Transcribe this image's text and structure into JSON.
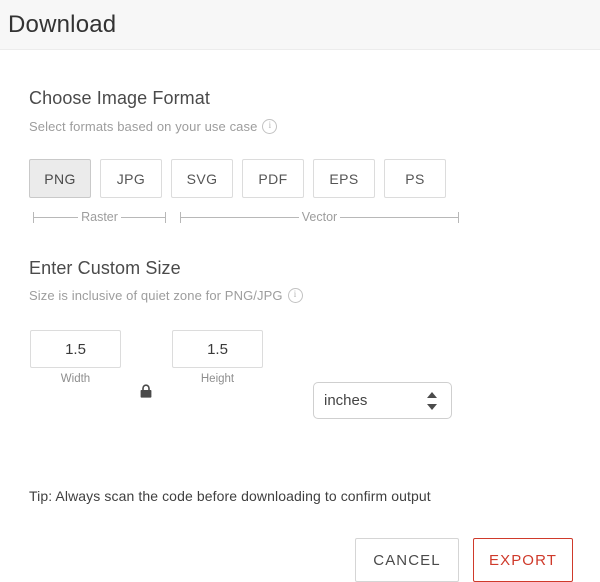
{
  "header": {
    "title": "Download"
  },
  "format_section": {
    "title": "Choose Image Format",
    "subtitle": "Select formats based on your use case",
    "info_icon": "info-circle-icon",
    "options": [
      {
        "label": "PNG",
        "selected": true
      },
      {
        "label": "JPG",
        "selected": false
      },
      {
        "label": "SVG",
        "selected": false
      },
      {
        "label": "PDF",
        "selected": false
      },
      {
        "label": "EPS",
        "selected": false
      },
      {
        "label": "PS",
        "selected": false
      }
    ],
    "groups": [
      {
        "label": "Raster"
      },
      {
        "label": "Vector"
      }
    ]
  },
  "size_section": {
    "title": "Enter Custom Size",
    "subtitle": "Size is inclusive of quiet zone for PNG/JPG",
    "info_icon": "info-circle-icon",
    "width": {
      "value": "1.5",
      "label": "Width"
    },
    "height": {
      "value": "1.5",
      "label": "Height"
    },
    "lock_icon": "lock-closed-icon",
    "unit": {
      "value": "inches",
      "arrows_icon": "stepper-arrows-icon"
    }
  },
  "tip": {
    "text": "Tip: Always scan the code before downloading to confirm output"
  },
  "footer": {
    "cancel_label": "CANCEL",
    "export_label": "EXPORT"
  },
  "colors": {
    "accent_red": "#cf3a2b",
    "header_bg": "#f7f7f7",
    "selected_bg": "#ebebeb",
    "muted_text": "#9d9d9d"
  }
}
